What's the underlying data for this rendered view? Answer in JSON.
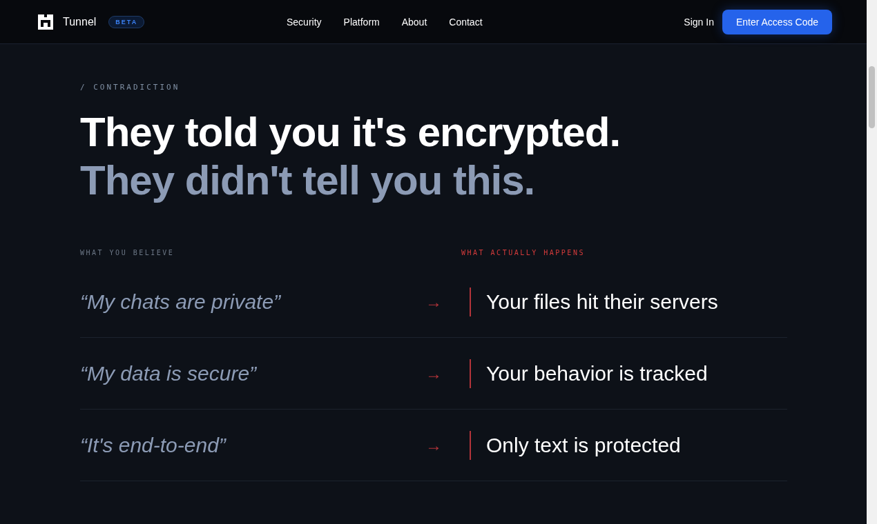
{
  "nav": {
    "brand": "Tunnel",
    "badge": "BETA",
    "links": [
      "Security",
      "Platform",
      "About",
      "Contact"
    ],
    "sign_in": "Sign In",
    "cta": "Enter Access Code"
  },
  "hero": {
    "eyebrow": "/ CONTRADICTION",
    "headline": "They told you it's encrypted.",
    "subheadline": "They didn't tell you this."
  },
  "comparison": {
    "left_heading": "WHAT YOU BELIEVE",
    "right_heading": "WHAT ACTUALLY HAPPENS",
    "arrow": "→",
    "rows": [
      {
        "belief": "“My chats are private”",
        "reality": "Your files hit their servers"
      },
      {
        "belief": "“My data is secure”",
        "reality": "Your behavior is tracked"
      },
      {
        "belief": "“It's end-to-end”",
        "reality": "Only text is protected"
      }
    ]
  }
}
